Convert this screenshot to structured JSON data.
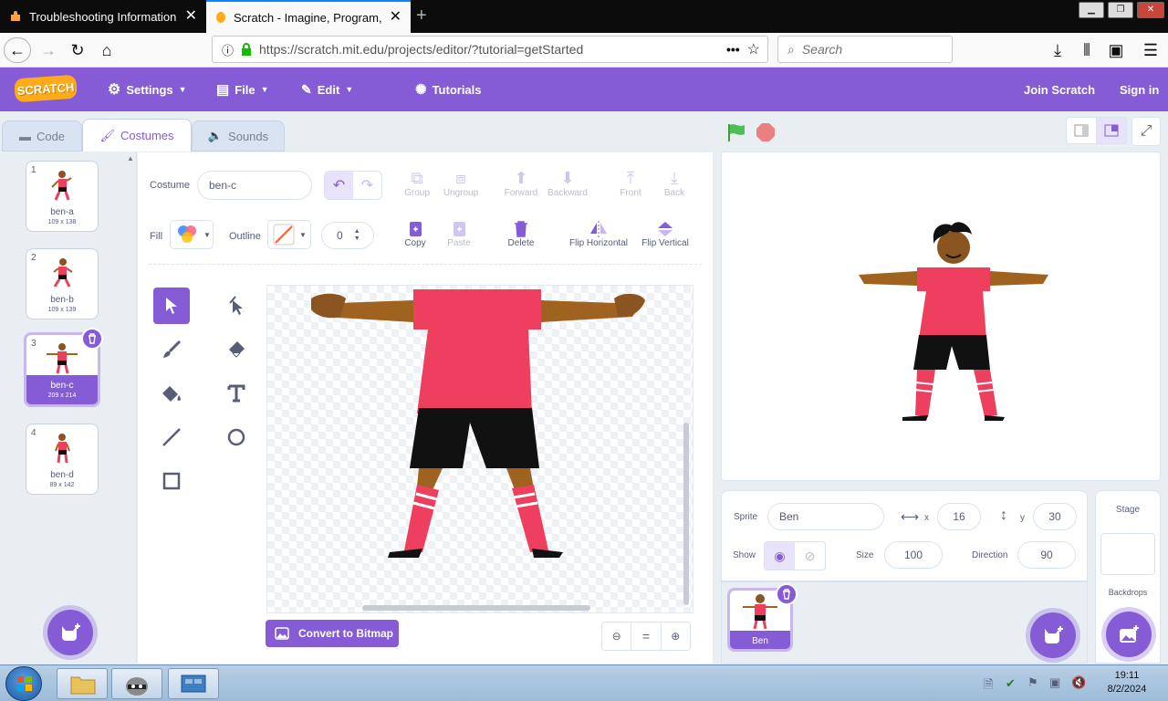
{
  "browser": {
    "tabs": [
      {
        "title": "Troubleshooting Information",
        "icon": "puzzle-icon"
      },
      {
        "title": "Scratch - Imagine, Program, Sh",
        "icon": "scratch-cat-icon",
        "active": true
      }
    ],
    "url": "https://scratch.mit.edu/projects/editor/?tutorial=getStarted",
    "search_placeholder": "Search"
  },
  "menubar": {
    "logo": "SCRATCH",
    "settings": "Settings",
    "file": "File",
    "edit": "Edit",
    "tutorials": "Tutorials",
    "join": "Join Scratch",
    "signin": "Sign in"
  },
  "tabs": {
    "code": "Code",
    "costumes": "Costumes",
    "sounds": "Sounds"
  },
  "costumes": [
    {
      "num": "1",
      "name": "ben-a",
      "size": "109 x 138"
    },
    {
      "num": "2",
      "name": "ben-b",
      "size": "109 x 139"
    },
    {
      "num": "3",
      "name": "ben-c",
      "size": "209 x 214"
    },
    {
      "num": "4",
      "name": "ben-d",
      "size": "89 x 142"
    }
  ],
  "paint": {
    "costume_label": "Costume",
    "costume_name": "ben-c",
    "group": "Group",
    "ungroup": "Ungroup",
    "forward": "Forward",
    "backward": "Backward",
    "front": "Front",
    "back": "Back",
    "fill_label": "Fill",
    "outline_label": "Outline",
    "outline_width": "0",
    "copy": "Copy",
    "paste": "Paste",
    "delete": "Delete",
    "flip_h": "Flip Horizontal",
    "flip_v": "Flip Vertical",
    "convert": "Convert to Bitmap",
    "zoom_reset": "="
  },
  "sprite": {
    "label": "Sprite",
    "name": "Ben",
    "x_label": "x",
    "x": "16",
    "y_label": "y",
    "y": "30",
    "show_label": "Show",
    "size_label": "Size",
    "size": "100",
    "direction_label": "Direction",
    "direction": "90",
    "tile_name": "Ben"
  },
  "stage_panel": {
    "title": "Stage",
    "backdrops": "Backdrops"
  },
  "taskbar": {
    "time": "19:11",
    "date": "8/2/2024"
  },
  "colors": {
    "accent": "#855cd6",
    "shirt": "#ef3f5f",
    "skin": "#a0631f"
  }
}
